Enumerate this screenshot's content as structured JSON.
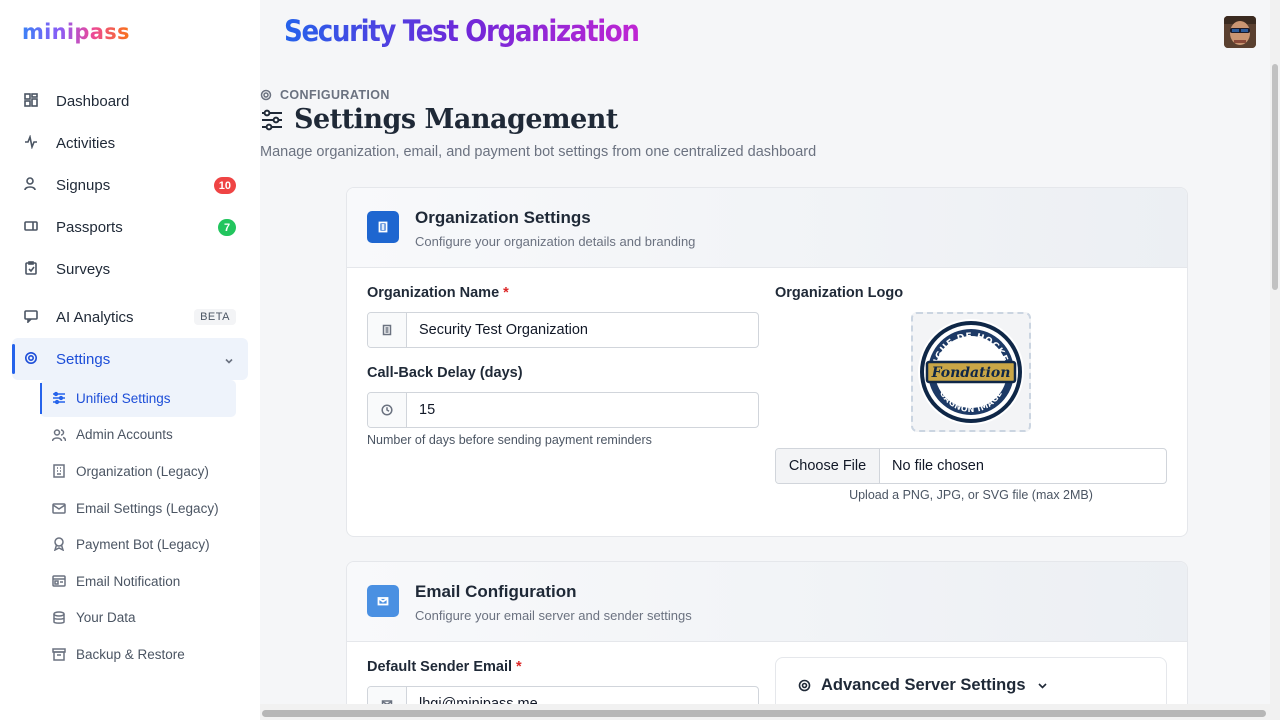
{
  "brand": {
    "name": "minipass"
  },
  "header": {
    "org_title": "Security Test Organization"
  },
  "sidebar": {
    "items": [
      {
        "label": "Dashboard",
        "icon": "dashboard-icon"
      },
      {
        "label": "Activities",
        "icon": "activity-icon"
      },
      {
        "label": "Signups",
        "icon": "user-icon",
        "badge": "10"
      },
      {
        "label": "Passports",
        "icon": "ticket-icon",
        "badge": "7"
      },
      {
        "label": "Surveys",
        "icon": "clipboard-icon"
      },
      {
        "label": "AI Analytics",
        "icon": "chat-icon",
        "tag": "BETA"
      },
      {
        "label": "Settings",
        "icon": "gear-icon"
      }
    ],
    "settings_sub": [
      {
        "label": "Unified Settings",
        "icon": "sliders-icon"
      },
      {
        "label": "Admin Accounts",
        "icon": "users-icon"
      },
      {
        "label": "Organization (Legacy)",
        "icon": "building-icon"
      },
      {
        "label": "Email Settings (Legacy)",
        "icon": "mail-icon"
      },
      {
        "label": "Payment Bot (Legacy)",
        "icon": "robot-icon"
      },
      {
        "label": "Email Notification",
        "icon": "template-icon"
      },
      {
        "label": "Your Data",
        "icon": "database-icon"
      },
      {
        "label": "Backup & Restore",
        "icon": "archive-icon"
      }
    ]
  },
  "page": {
    "breadcrumb": "CONFIGURATION",
    "title": "Settings Management",
    "subtitle": "Manage organization, email, and payment bot settings from one centralized dashboard"
  },
  "org_card": {
    "title": "Organization Settings",
    "subtitle": "Configure your organization details and branding",
    "name_label": "Organization Name",
    "required_mark": "*",
    "name_value": "Security Test Organization",
    "delay_label": "Call-Back Delay (days)",
    "delay_value": "15",
    "delay_help": "Number of days before sending payment reminders",
    "logo_label": "Organization Logo",
    "logo_text_top": "LIGUE DE HOCKEY",
    "logo_text_mid": "Fondation",
    "logo_text_bottom": "GAGNON IMAGE",
    "file_button": "Choose File",
    "file_status": "No file chosen",
    "file_help": "Upload a PNG, JPG, or SVG file (max 2MB)"
  },
  "email_card": {
    "title": "Email Configuration",
    "subtitle": "Configure your email server and sender settings",
    "sender_label": "Default Sender Email",
    "required_mark": "*",
    "sender_value": "lhgi@minipass.me",
    "advanced_label": "Advanced Server Settings"
  },
  "colors": {
    "accent": "#2563eb",
    "org_icon_bg": "#1e66d0",
    "email_icon_bg": "#4a90e2",
    "badge_red": "#ef4444",
    "badge_green": "#22c55e"
  }
}
